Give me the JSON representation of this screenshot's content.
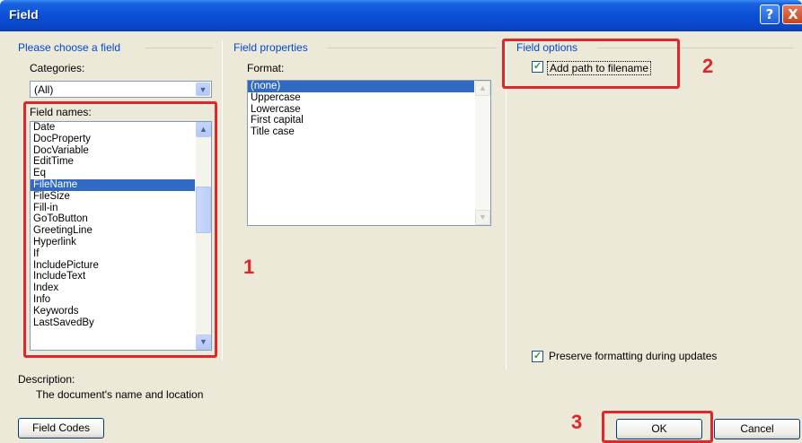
{
  "window": {
    "title": "Field"
  },
  "titlebar_buttons": {
    "help": "?",
    "close": "X"
  },
  "left_group": {
    "title": "Please choose a field",
    "categories_label": "Categories:",
    "categories_value": "(All)",
    "field_names_label": "Field names:",
    "field_names": [
      "Date",
      "DocProperty",
      "DocVariable",
      "EditTime",
      "Eq",
      "FileName",
      "FileSize",
      "Fill-in",
      "GoToButton",
      "GreetingLine",
      "Hyperlink",
      "If",
      "IncludePicture",
      "IncludeText",
      "Index",
      "Info",
      "Keywords",
      "LastSavedBy"
    ],
    "selected_field": "FileName"
  },
  "middle_group": {
    "title": "Field properties",
    "format_label": "Format:",
    "formats": [
      "(none)",
      "Uppercase",
      "Lowercase",
      "First capital",
      "Title case"
    ],
    "selected_format": "(none)"
  },
  "right_group": {
    "title": "Field options",
    "add_path_label": "Add path to filename",
    "add_path_checked": true,
    "preserve_label": "Preserve formatting during updates",
    "preserve_checked": true
  },
  "description": {
    "label": "Description:",
    "text": "The document's name and location"
  },
  "buttons": {
    "field_codes": "Field Codes",
    "ok": "OK",
    "cancel": "Cancel"
  },
  "callouts": {
    "one": "1",
    "two": "2",
    "three": "3"
  },
  "colors": {
    "title_bar": "#0a4fd6",
    "group_title": "#0046d5",
    "selection": "#316ac5",
    "annotation": "#e0262a",
    "dialog_bg": "#ece9d8"
  }
}
